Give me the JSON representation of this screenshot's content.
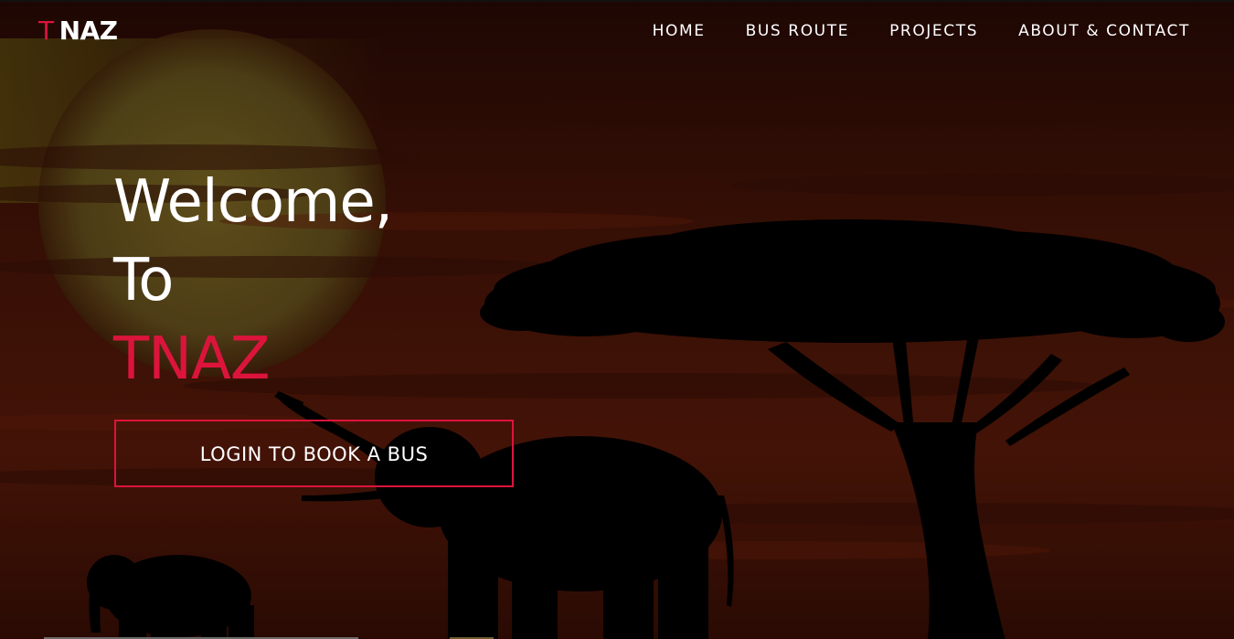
{
  "brand": {
    "accent_letter": "T",
    "name": "NAZ"
  },
  "nav": {
    "items": [
      {
        "label": "HOME"
      },
      {
        "label": "BUS ROUTE"
      },
      {
        "label": "PROJECTS"
      },
      {
        "label": "ABOUT & CONTACT"
      }
    ]
  },
  "hero": {
    "line1": "Welcome,",
    "line2": "To",
    "line3": "TNAZ",
    "cta_label": "LOGIN TO BOOK A BUS"
  },
  "colors": {
    "accent": "#dc143c",
    "text": "#ffffff",
    "sky_dark": "#3a0d06",
    "sky_mid": "#6b1e0c",
    "sun": "#c9b23a",
    "silhouette": "#000000"
  },
  "background": {
    "icon": "savanna-sunset-illustration"
  }
}
